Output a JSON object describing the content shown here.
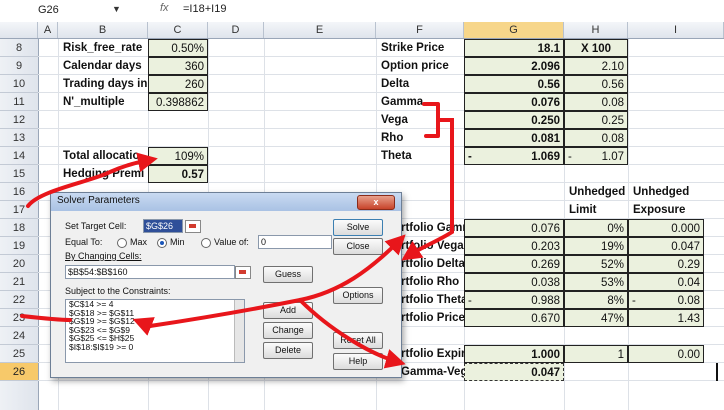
{
  "formula_bar": {
    "name_box": "G26",
    "fx": "fx",
    "formula": "=I18+I19"
  },
  "columns": [
    "A",
    "B",
    "C",
    "D",
    "E",
    "F",
    "G",
    "H",
    "I"
  ],
  "rows": [
    "8",
    "9",
    "10",
    "11",
    "12",
    "13",
    "14",
    "15",
    "16",
    "17",
    "18",
    "19",
    "20",
    "21",
    "22",
    "23",
    "24",
    "25",
    "26"
  ],
  "left_block": {
    "r8": {
      "label": "Risk_free_rate",
      "value": "0.50%"
    },
    "r9": {
      "label": "Calendar days",
      "value": "360"
    },
    "r10": {
      "label": "Trading days in",
      "value": "260"
    },
    "r11": {
      "label": "N'_multiple",
      "value": "0.398862"
    },
    "r14": {
      "label": "Total allocatio",
      "value": "109%"
    },
    "r15": {
      "label": "Hedging Premi",
      "value": "0.57"
    }
  },
  "greeks": [
    {
      "label": "Strike Price",
      "g": "18.1",
      "h": "X 100"
    },
    {
      "label": "Option price",
      "g": "2.096",
      "h": "2.10"
    },
    {
      "label": "Delta",
      "g": "0.56",
      "h": "0.56"
    },
    {
      "label": "Gamma",
      "g": "0.076",
      "h": "0.08"
    },
    {
      "label": "Vega",
      "g": "0.250",
      "h": "0.25"
    },
    {
      "label": "Rho",
      "g": "0.081",
      "h": "0.08"
    },
    {
      "label": "Theta",
      "g_sign": "-",
      "g": "1.069",
      "h_sign": "-",
      "h": "1.07"
    }
  ],
  "headers": {
    "h16": "Unhedged",
    "i16": "Unhedged",
    "h17": "Limit",
    "i17": "Exposure"
  },
  "portfolio": [
    {
      "label": "rtfolio Gamr",
      "g": "0.076",
      "h": "0%",
      "i": "0.000"
    },
    {
      "label": "rtfolio Vega",
      "g": "0.203",
      "h": "19%",
      "i": "0.047"
    },
    {
      "label": "rtfolio Delta",
      "g": "0.269",
      "h": "52%",
      "i": "0.29"
    },
    {
      "label": "rtfolio Rho",
      "g": "0.038",
      "h": "53%",
      "i": "0.04"
    },
    {
      "label": "rtfolio Theta",
      "g_sign": "-",
      "g": "0.988",
      "h": "8%",
      "i_sign": "-",
      "i": "0.08"
    },
    {
      "label": "rtfolio Price",
      "g": "0.670",
      "h": "47%",
      "i": "1.43"
    }
  ],
  "r25": {
    "label": "rtfolio Expiry",
    "g": "1.000",
    "h": "1",
    "i": "0.00"
  },
  "r26": {
    "label": "Gamma-Vega-",
    "g": "0.047"
  },
  "dialog": {
    "title": "Solver Parameters",
    "close": "x",
    "set_target_label": "Set Target Cell:",
    "target_value": "$G$26",
    "equal_to_label": "Equal To:",
    "max_label": "Max",
    "min_label": "Min",
    "value_of_label": "Value of:",
    "value_of_input": "0",
    "changing_cells_label": "By Changing Cells:",
    "changing_cells_value": "$B$54:$B$160",
    "guess": "Guess",
    "constraints_label": "Subject to the Constraints:",
    "constraints": [
      "$C$14 >= 4",
      "$G$18 >= $G$11",
      "$G$19 >= $G$12",
      "$G$23 <= $G$9",
      "$G$25 <= $H$25",
      "$I$18:$I$19 >= 0"
    ],
    "solve": "Solve",
    "close_btn": "Close",
    "options": "Options",
    "add": "Add",
    "change": "Change",
    "reset_all": "Reset All",
    "delete": "Delete",
    "help": "Help"
  },
  "colors": {
    "green_fill": "#ebf1de",
    "arrow_red": "#e8161b",
    "selected_row": "#f7c96a"
  }
}
